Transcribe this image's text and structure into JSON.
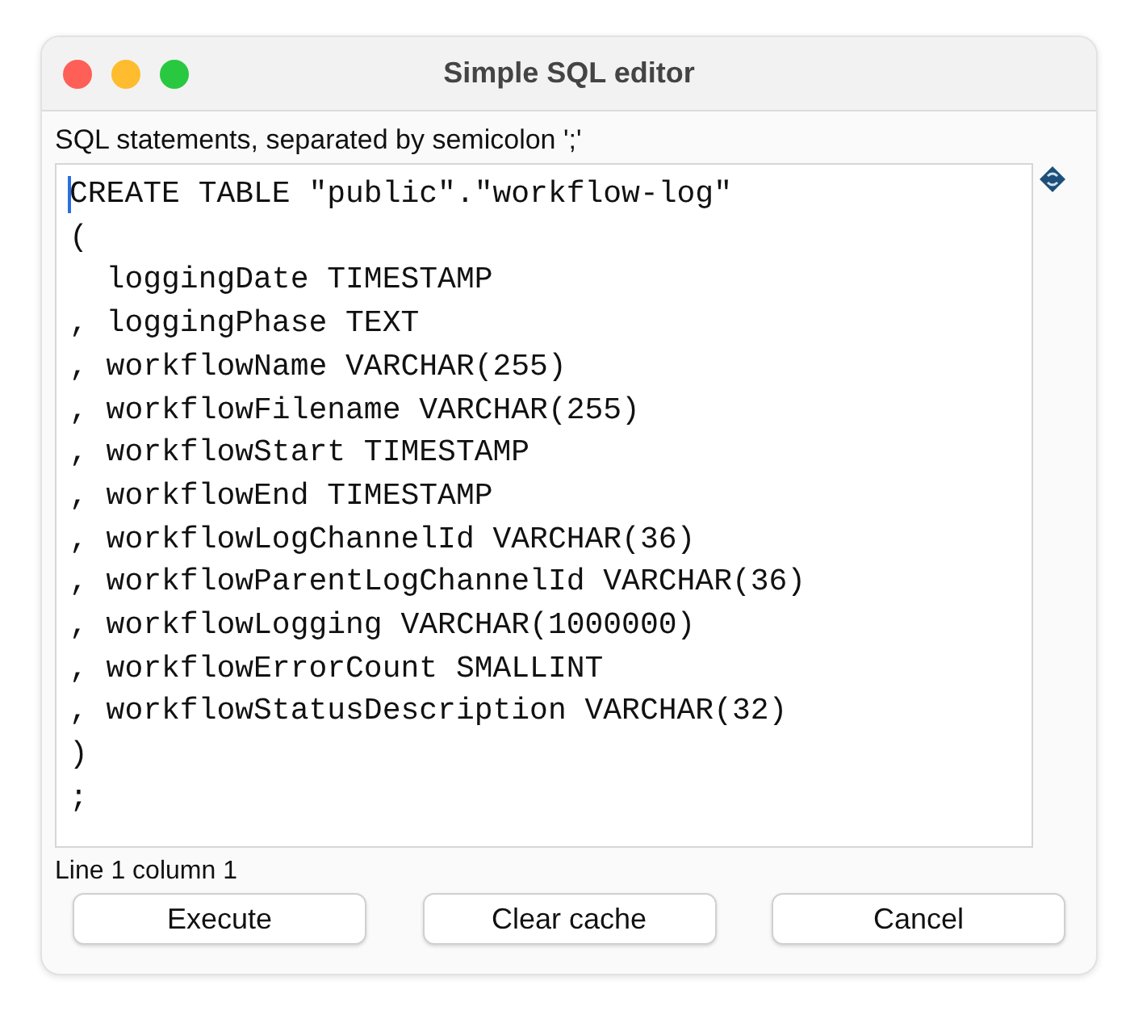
{
  "window": {
    "title": "Simple SQL editor"
  },
  "editor_label": "SQL statements, separated by semicolon ';'",
  "editor": {
    "lines": [
      "CREATE TABLE \"public\".\"workflow-log\"",
      "(",
      "  loggingDate TIMESTAMP",
      ", loggingPhase TEXT",
      ", workflowName VARCHAR(255)",
      ", workflowFilename VARCHAR(255)",
      ", workflowStart TIMESTAMP",
      ", workflowEnd TIMESTAMP",
      ", workflowLogChannelId VARCHAR(36)",
      ", workflowParentLogChannelId VARCHAR(36)",
      ", workflowLogging VARCHAR(1000000)",
      ", workflowErrorCount SMALLINT",
      ", workflowStatusDescription VARCHAR(32)",
      ")",
      ";"
    ]
  },
  "status_bar": "Line 1 column 1",
  "buttons": [
    "Execute",
    "Clear cache",
    "Cancel"
  ]
}
